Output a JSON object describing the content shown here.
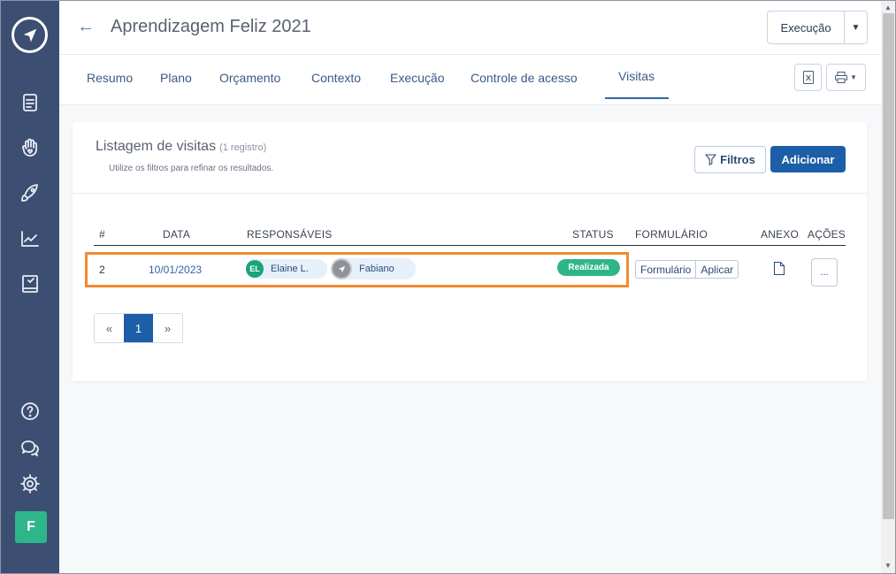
{
  "header": {
    "title": "Aprendizagem Feliz 2021",
    "exec_button": "Execução"
  },
  "tabs": [
    {
      "label": "Resumo"
    },
    {
      "label": "Plano"
    },
    {
      "label": "Orçamento"
    },
    {
      "label": "Contexto"
    },
    {
      "label": "Execução"
    },
    {
      "label": "Controle de acesso"
    },
    {
      "label": "Visitas",
      "active": true
    }
  ],
  "sidebar": {
    "items": [
      "document-icon",
      "hand-heart-icon",
      "rocket-icon",
      "chart-icon",
      "book-icon"
    ],
    "bottom": [
      "help-icon",
      "chat-icon",
      "gear-icon"
    ],
    "user_initial": "F"
  },
  "card": {
    "title": "Listagem de visitas",
    "count": "(1 registro)",
    "subtitle": "Utilize os filtros para refinar os resultados.",
    "filter_label": "Filtros",
    "add_label": "Adicionar"
  },
  "table": {
    "headers": [
      "#",
      "DATA",
      "RESPONSÁVEIS",
      "STATUS",
      "FORMULÁRIO",
      "ANEXO",
      "AÇÕES"
    ],
    "rows": [
      {
        "id": "2",
        "date": "10/01/2023",
        "responsaveis": [
          {
            "initials": "EL",
            "name": "Elaine L.",
            "color": "#1aa37a"
          },
          {
            "initials": "",
            "name": "Fabiano",
            "color": "#8f9399"
          }
        ],
        "status": "Realizada",
        "form_label": "Formulário",
        "apply_label": "Aplicar",
        "actions_label": "..."
      }
    ]
  },
  "pagination": {
    "prev": "«",
    "current": "1",
    "next": "»"
  },
  "colors": {
    "sidebar": "#3c4e72",
    "primary": "#1d5ea8",
    "success": "#2fb58a",
    "highlight": "#f28a30"
  }
}
